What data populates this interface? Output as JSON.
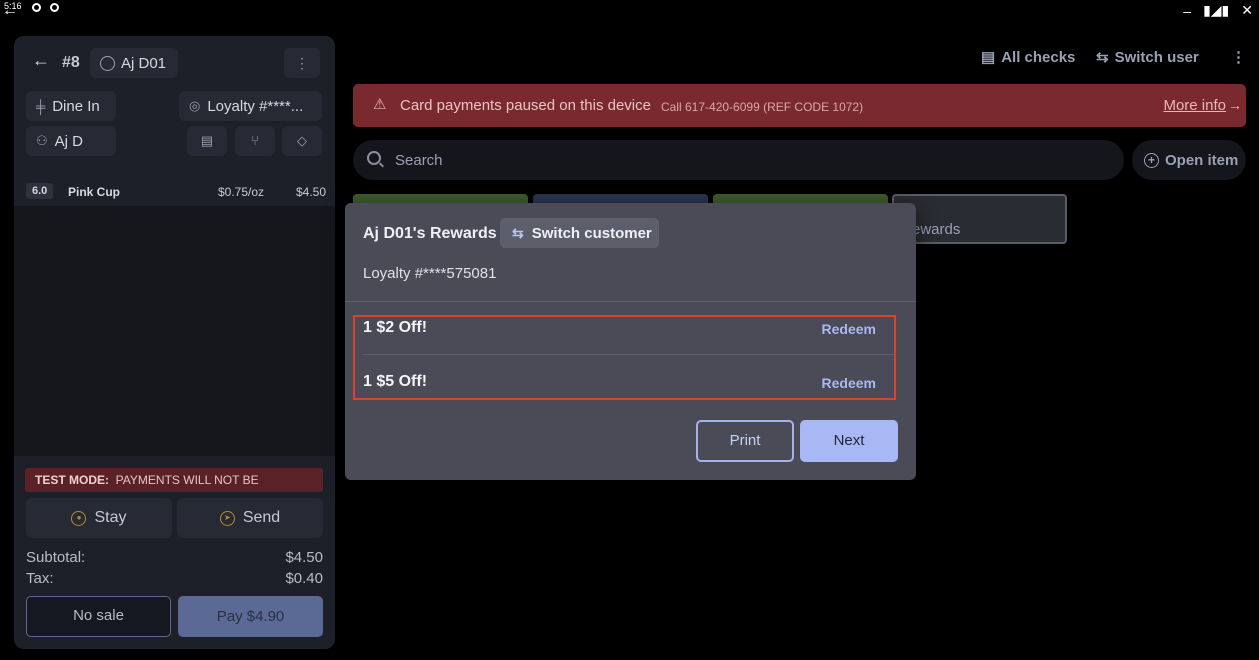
{
  "statusbar": {
    "time": "5:16"
  },
  "order": {
    "number": "#8",
    "customer_short": "Aj D01",
    "dine_option": "Dine In",
    "loyalty": "Loyalty #****...",
    "server": "Aj D",
    "items": [
      {
        "qty": "6.0",
        "name": "Pink Cup",
        "unit_price": "$0.75/oz",
        "price": "$4.50"
      }
    ],
    "test_mode_label": "TEST MODE:",
    "test_mode_text": "PAYMENTS WILL NOT BE PROCESSED",
    "stay_label": "Stay",
    "send_label": "Send",
    "subtotal_label": "Subtotal:",
    "subtotal_value": "$4.50",
    "tax_label": "Tax:",
    "tax_value": "$0.40",
    "no_sale_label": "No sale",
    "pay_label": "Pay $4.90"
  },
  "topnav": {
    "all_checks": "All checks",
    "switch_user": "Switch user"
  },
  "alert": {
    "text": "Card payments paused on this device",
    "sub": "Call 617-420-6099 (REF CODE 1072)",
    "more_info": "More info",
    "color": "#7a2a2e"
  },
  "search": {
    "placeholder": "Search",
    "open_item": "Open item"
  },
  "tiles": [
    {
      "label": "",
      "color": "#3e5a2c"
    },
    {
      "label": "",
      "color": "#2a3550"
    },
    {
      "label": "",
      "color": "#3e5a2c"
    },
    {
      "label": "ewards",
      "color": "#2a2c33"
    }
  ],
  "modal": {
    "title": "Aj D01's Rewards",
    "switch_customer": "Switch customer",
    "loyalty_line": "Loyalty #****575081",
    "rewards": [
      {
        "name": "1 $2 Off!",
        "action": "Redeem"
      },
      {
        "name": "1 $5 Off!",
        "action": "Redeem"
      }
    ],
    "print_label": "Print",
    "next_label": "Next",
    "accent": "#a8b8f4"
  }
}
